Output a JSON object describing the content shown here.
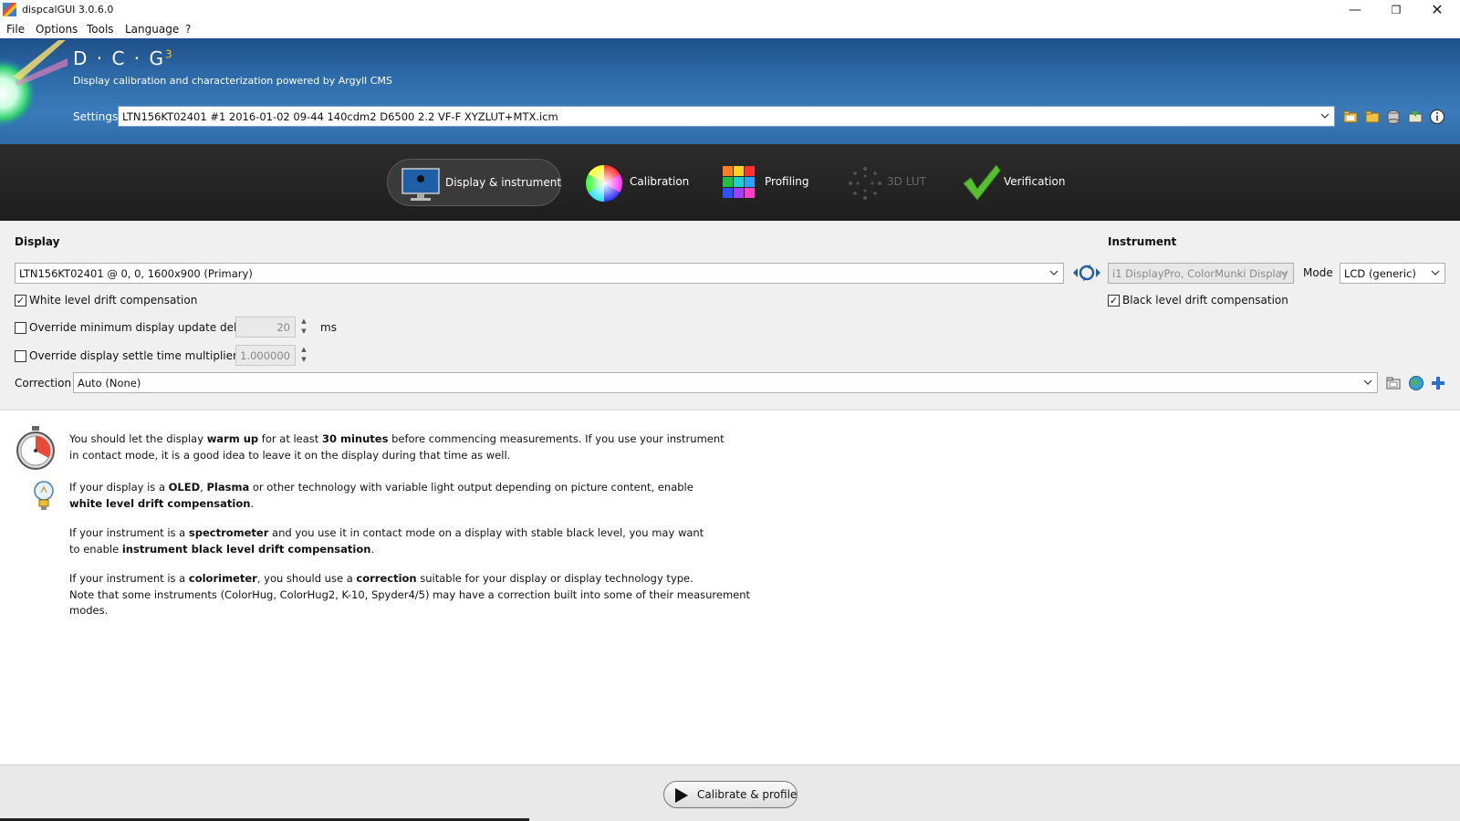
{
  "window": {
    "title": "dispcalGUI 3.0.6.0"
  },
  "menu": [
    "File",
    "Options",
    "Tools",
    "Language",
    "?"
  ],
  "header": {
    "logo": "D · C · G",
    "logo_sup": "3",
    "tagline": "Display calibration and characterization powered by Argyll CMS",
    "settings_label": "Settings",
    "settings_value": "LTN156KT02401 #1 2016-01-02 09-44 140cdm2 D6500 2.2 VF-F XYZLUT+MTX.icm"
  },
  "tabs": [
    {
      "label": "Display & instrument",
      "active": true
    },
    {
      "label": "Calibration"
    },
    {
      "label": "Profiling"
    },
    {
      "label": "3D LUT",
      "disabled": true
    },
    {
      "label": "Verification"
    }
  ],
  "display": {
    "heading": "Display",
    "selected": "LTN156KT02401 @ 0, 0, 1600x900 (Primary)",
    "white_drift_label": "White level drift compensation",
    "white_drift_checked": true,
    "min_delay_label": "Override minimum display update delay",
    "min_delay_value": "20",
    "min_delay_unit": "ms",
    "settle_label": "Override display settle time multiplier",
    "settle_value": "1.000000",
    "correction_label": "Correction",
    "correction_value": "Auto (None)"
  },
  "instrument": {
    "heading": "Instrument",
    "selected": "i1 DisplayPro, ColorMunki Display",
    "mode_label": "Mode",
    "mode_value": "LCD (generic)",
    "black_drift_label": "Black level drift compensation",
    "black_drift_checked": true
  },
  "info": {
    "p1_a": "You should let the display ",
    "p1_b": "warm up",
    "p1_c": " for at least ",
    "p1_d": "30 minutes",
    "p1_e": " before commencing measurements. If you use your instrument",
    "p1_f": "in contact mode, it is a good idea to leave it on the display during that time as well.",
    "p2_a": "If your display is a ",
    "p2_b": "OLED",
    "p2_c": ", ",
    "p2_d": "Plasma",
    "p2_e": " or other technology with variable light output depending on picture content, enable",
    "p2_f": "white level drift compensation",
    "p2_g": ".",
    "p3_a": "If your instrument is a ",
    "p3_b": "spectrometer",
    "p3_c": " and you use it in contact mode on a display with stable black level, you may want",
    "p3_d": "to enable ",
    "p3_e": "instrument black level drift compensation",
    "p3_f": ".",
    "p4_a": "If your instrument is a ",
    "p4_b": "colorimeter",
    "p4_c": ", you should use a ",
    "p4_d": "correction",
    "p4_e": " suitable for your display or display technology type.",
    "p4_f": "Note that some instruments (ColorHug, ColorHug2, K-10, Spyder4/5) may have a correction built into some of their measurement",
    "p4_g": "modes."
  },
  "footer": {
    "cta_label": "Calibrate & profile"
  }
}
